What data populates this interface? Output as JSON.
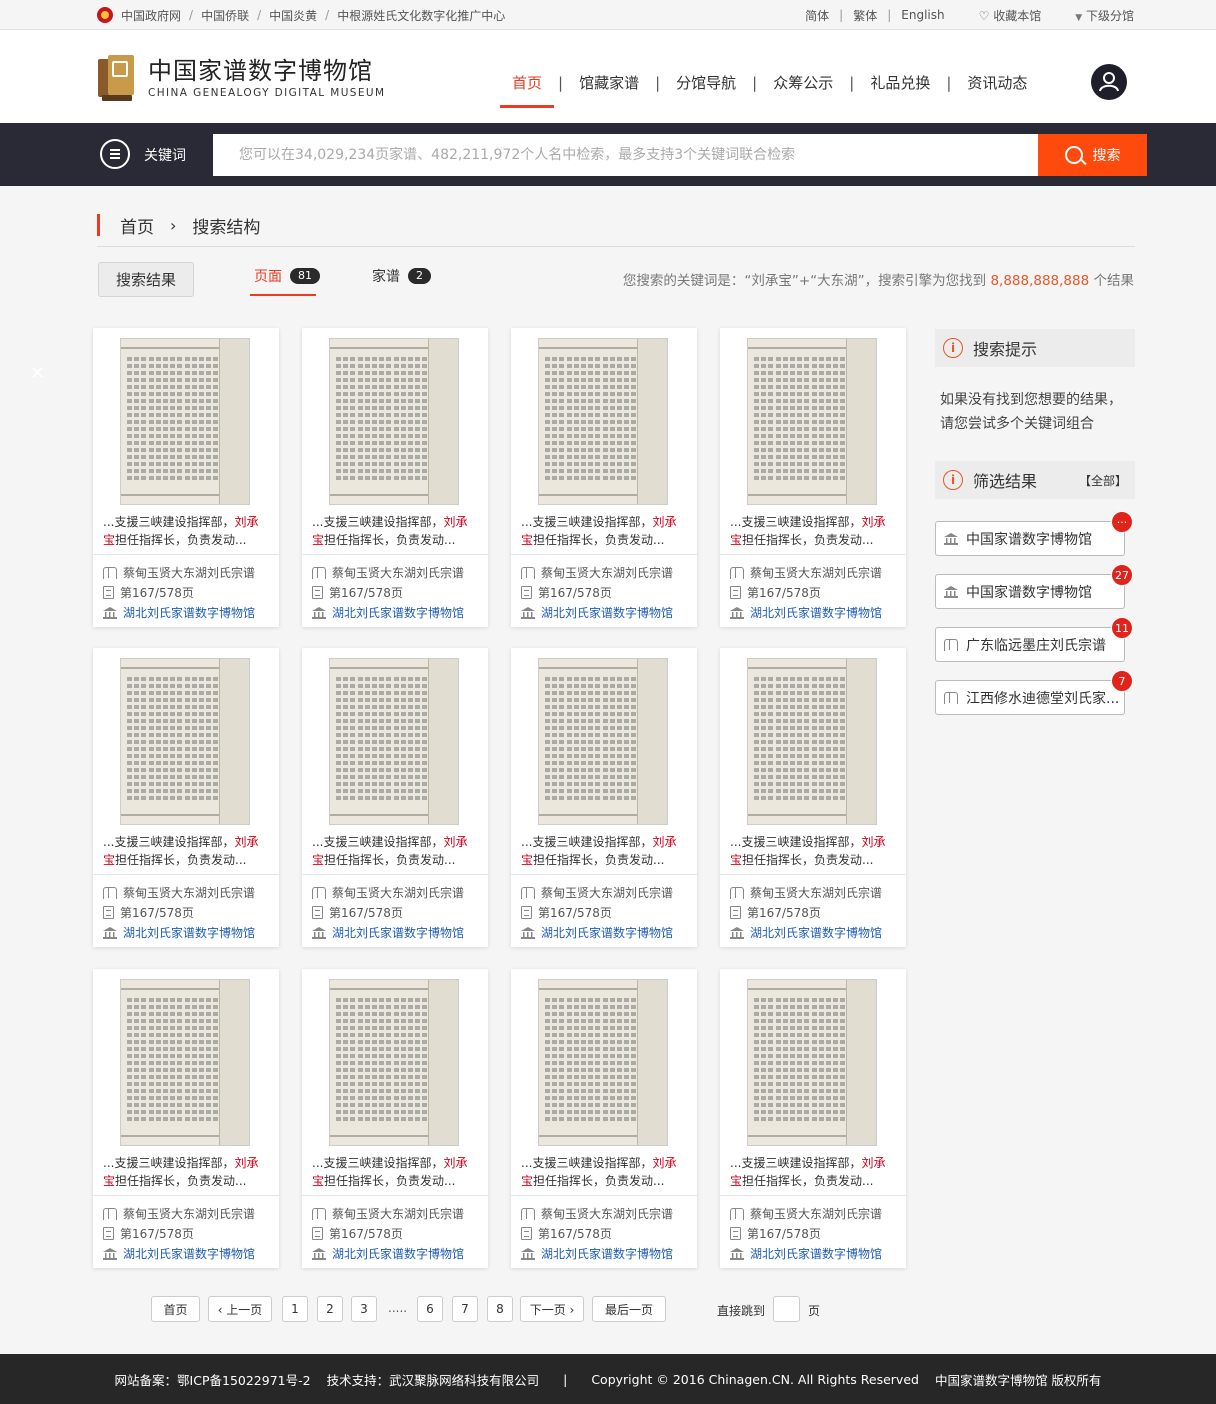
{
  "topbar": {
    "links": [
      "中国政府网",
      "中国侨联",
      "中国炎黄",
      "中根源姓氏文化数字化推广中心"
    ],
    "lang_simplified": "简体",
    "lang_traditional": "繁体",
    "lang_english": "English",
    "favorite": "收藏本馆",
    "sub_branch": "下级分馆"
  },
  "logo": {
    "cn": "中国家谱数字博物馆",
    "en": "CHINA GENEALOGY DIGITAL MUSEUM"
  },
  "nav": [
    "首页",
    "馆藏家谱",
    "分馆导航",
    "众筹公示",
    "礼品兑换",
    "资讯动态"
  ],
  "search": {
    "label": "关键词",
    "placeholder": "您可以在34,029,234页家谱、482,211,972个人名中检索，最多支持3个关键词联合检索",
    "button": "搜索"
  },
  "breadcrumb": {
    "home": "首页",
    "current": "搜索结构"
  },
  "result_button": "搜索结果",
  "tabs": [
    {
      "label": "页面",
      "count": "81"
    },
    {
      "label": "家谱",
      "count": "2"
    }
  ],
  "summary": {
    "prefix": "您搜索的关键词是：“刘承宝”+“大东湖”，搜索引擎为您找到",
    "count": "8,888,888,888",
    "suffix": "个结果"
  },
  "card": {
    "snippet_before": "...支援三峡建设指挥部，",
    "snippet_highlight1": "刘承",
    "snippet_highlight2": "宝",
    "snippet_after": "担任指挥长，负责发动...",
    "book": "蔡甸玉贤大东湖刘氏宗谱",
    "page": "第167/578页",
    "museum": "湖北刘氏家谱数字博物馆"
  },
  "sidebar": {
    "tips_title": "搜索提示",
    "tips_text": "如果没有找到您想要的结果，请您尝试多个关键词组合",
    "filter_title": "筛选结果",
    "filter_all": "【全部】",
    "filters": [
      {
        "name": "中国家谱数字博物馆",
        "count": "···",
        "icon": "museum-icon"
      },
      {
        "name": "中国家谱数字博物馆",
        "count": "27",
        "icon": "museum-icon"
      },
      {
        "name": "广东临远墨庄刘氏宗谱",
        "count": "11",
        "icon": "book-icon"
      },
      {
        "name": "江西修水迪德堂刘氏家...",
        "count": "7",
        "icon": "book-icon"
      }
    ]
  },
  "pagination": {
    "first": "首页",
    "prev": "‹ 上一页",
    "next": "下一页 ›",
    "last": "最后一页",
    "pages": [
      "1",
      "2",
      "3",
      "6",
      "7",
      "8"
    ],
    "dots": ".....",
    "jump_label": "直接跳到",
    "jump_unit": "页"
  },
  "footer": {
    "icp": "网站备案：鄂ICP备15022971号-2",
    "support": "技术支持：武汉聚脉网络科技有限公司",
    "divider": "|",
    "copyright": "Copyright © 2016  Chinagen.CN. All Rights Reserved",
    "owner": "中国家谱数字博物馆 版权所有"
  },
  "colors": {
    "accent": "#e83d23",
    "search_button": "#ff4a0e",
    "dark_bar": "#2a2a36",
    "link": "#1d5bb5",
    "badge_red": "#e0241b"
  }
}
